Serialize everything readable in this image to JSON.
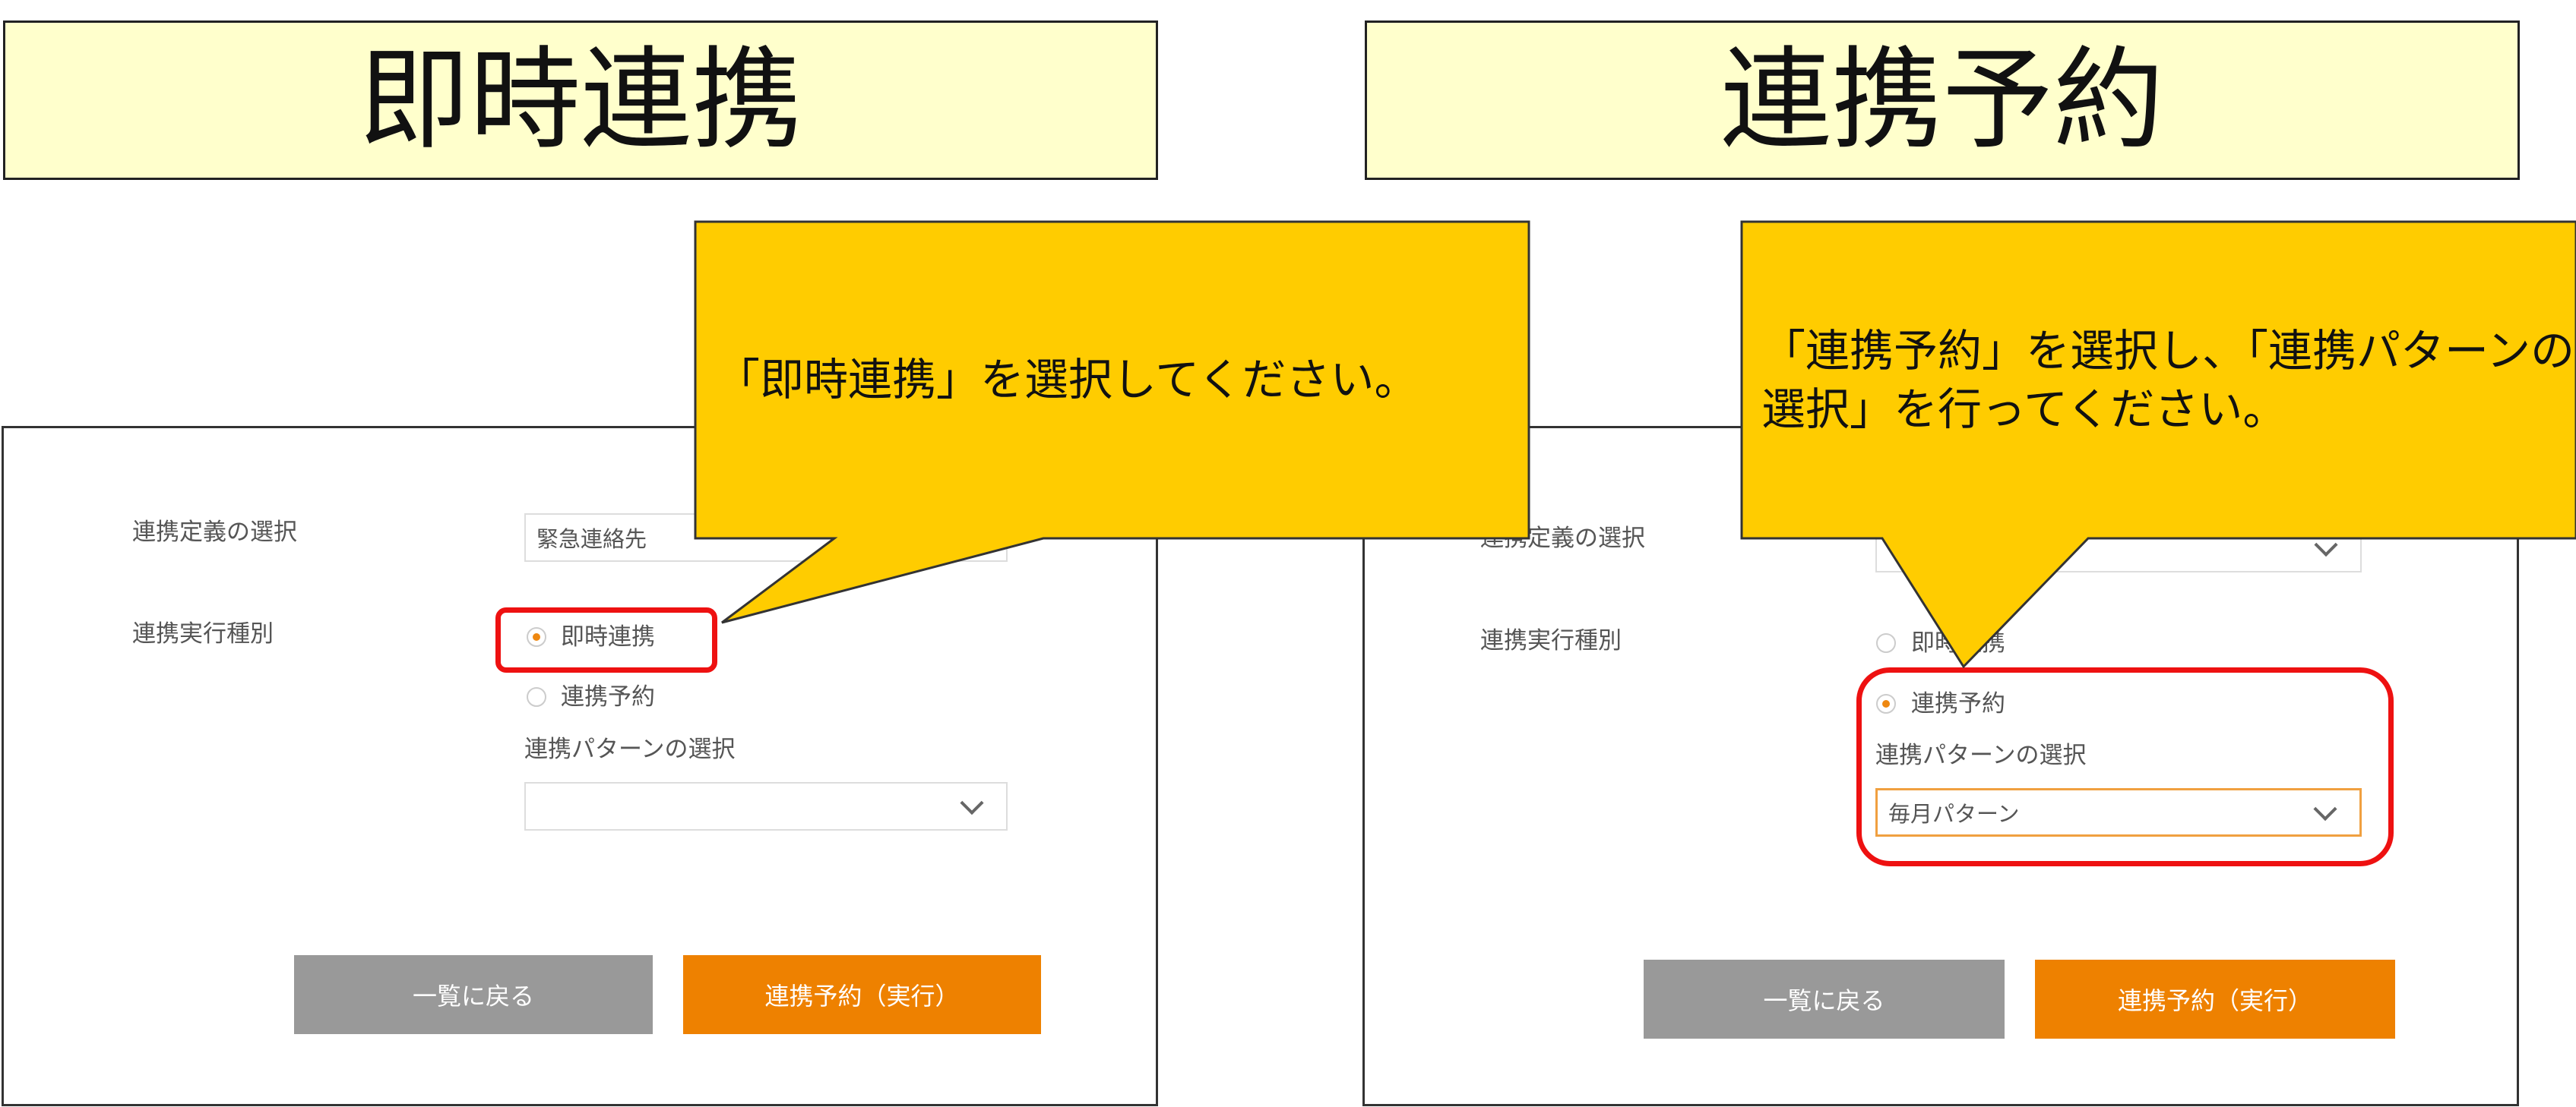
{
  "titles": {
    "left": "即時連携",
    "right": "連携予約"
  },
  "callouts": {
    "left": "「即時連携」を選択してください。",
    "right_line1": "「連携予約」を選択し、「連携パターンの",
    "right_line2": "選択」を行ってください。"
  },
  "left_panel": {
    "definition_label": "連携定義の選択",
    "definition_value": "緊急連絡先",
    "exec_type_label": "連携実行種別",
    "option_immediate": "即時連携",
    "option_reserve": "連携予約",
    "pattern_label": "連携パターンの選択",
    "pattern_value": "",
    "back_button": "一覧に戻る",
    "submit_button": "連携予約（実行）",
    "selected_option": "即時連携"
  },
  "right_panel": {
    "definition_label": "連携定義の選択",
    "exec_type_label": "連携実行種別",
    "option_immediate": "即時連携",
    "option_reserve": "連携予約",
    "pattern_label": "連携パターンの選択",
    "pattern_value": "毎月パターン",
    "back_button": "一覧に戻る",
    "submit_button": "連携予約（実行）",
    "selected_option": "連携予約"
  },
  "colors": {
    "title_bg": "#ffffcc",
    "callout_bg": "#ffcc00",
    "highlight": "#ee1111",
    "accent_orange": "#ee8100",
    "gray_button": "#999999"
  },
  "icons": {
    "dropdown": "chevron-down-icon",
    "radio_selected": "radio-checked-icon",
    "radio_unselected": "radio-unchecked-icon"
  }
}
